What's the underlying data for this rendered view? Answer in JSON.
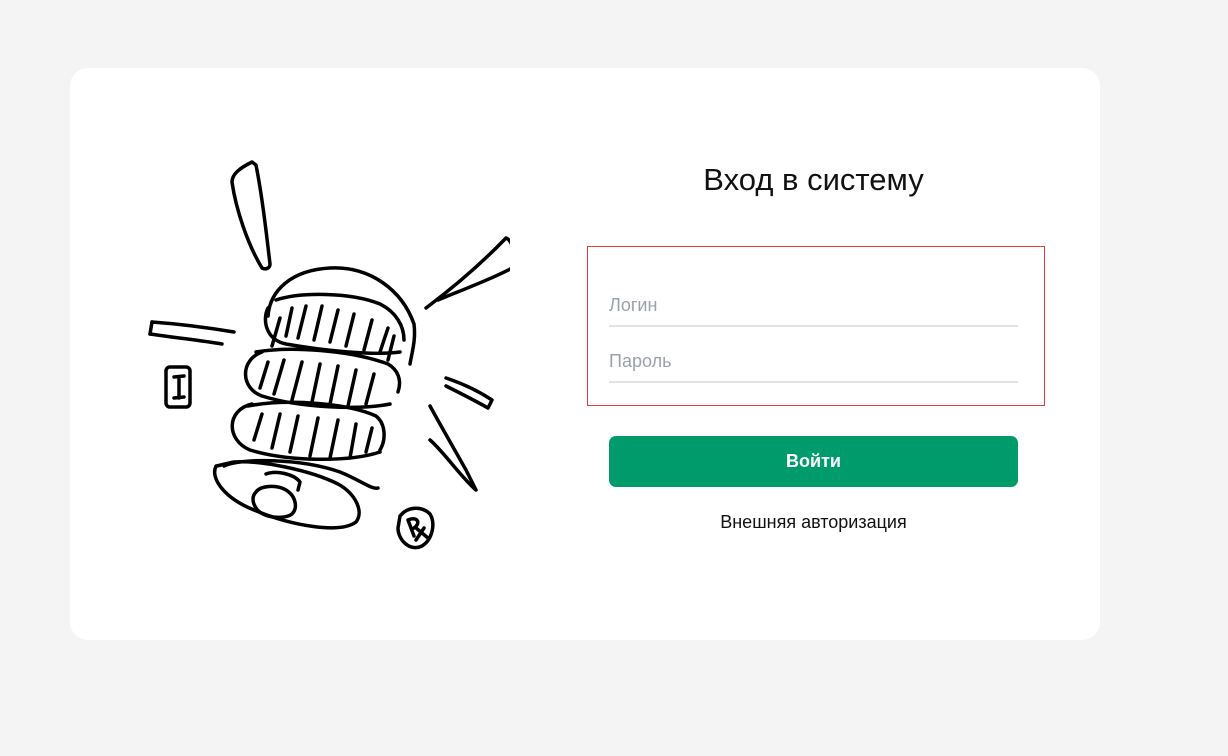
{
  "login_form": {
    "title": "Вход в систему",
    "login_placeholder": "Логин",
    "login_value": "",
    "password_placeholder": "Пароль",
    "password_value": "",
    "submit_label": "Войти",
    "external_auth_label": "Внешняя авторизация"
  },
  "illustration": {
    "icon": "spring-pills-sketch-icon",
    "badges": [
      "I",
      "Rx"
    ]
  },
  "colors": {
    "page_background": "#f4f4f4",
    "card_background": "#ffffff",
    "primary_button": "#009b6a",
    "highlight_border": "#e53935",
    "field_underline": "#e1e3e8",
    "placeholder": "#9aa0ab"
  }
}
